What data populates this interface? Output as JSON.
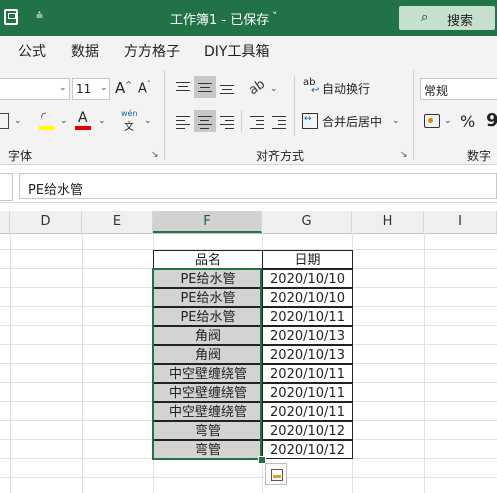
{
  "titlebar": {
    "save_icon": "save-icon",
    "qa_more": "⩮",
    "title": "工作簿1 - 已保存",
    "title_arrow": "˅",
    "search_icon": "⌕",
    "search_label": "搜索",
    "bg": "#217346"
  },
  "tabs": [
    "公式",
    "数据",
    "方方格子",
    "DIY工具箱"
  ],
  "ribbon": {
    "font_size": "11",
    "grow": "A",
    "shrink": "A",
    "phonetic_top": "wén",
    "phonetic_bottom": "文",
    "wrap_text": "自动换行",
    "merge_center": "合并后居中",
    "number_format": "常规",
    "percent": "%",
    "comma": "9",
    "group_font": "字体",
    "group_align": "对齐方式",
    "group_number": "数字"
  },
  "formula_bar": {
    "content": "PE给水管"
  },
  "columns": [
    "D",
    "E",
    "F",
    "G",
    "H",
    "I"
  ],
  "selected_column": "F",
  "table": {
    "headers": [
      "品名",
      "日期"
    ],
    "rows": [
      [
        "PE给水管",
        "2020/10/10"
      ],
      [
        "PE给水管",
        "2020/10/10"
      ],
      [
        "PE给水管",
        "2020/10/11"
      ],
      [
        "角阀",
        "2020/10/13"
      ],
      [
        "角阀",
        "2020/10/13"
      ],
      [
        "中空壁缠绕管",
        "2020/10/11"
      ],
      [
        "中空壁缠绕管",
        "2020/10/11"
      ],
      [
        "中空壁缠绕管",
        "2020/10/11"
      ],
      [
        "弯管",
        "2020/10/12"
      ],
      [
        "弯管",
        "2020/10/12"
      ]
    ]
  }
}
